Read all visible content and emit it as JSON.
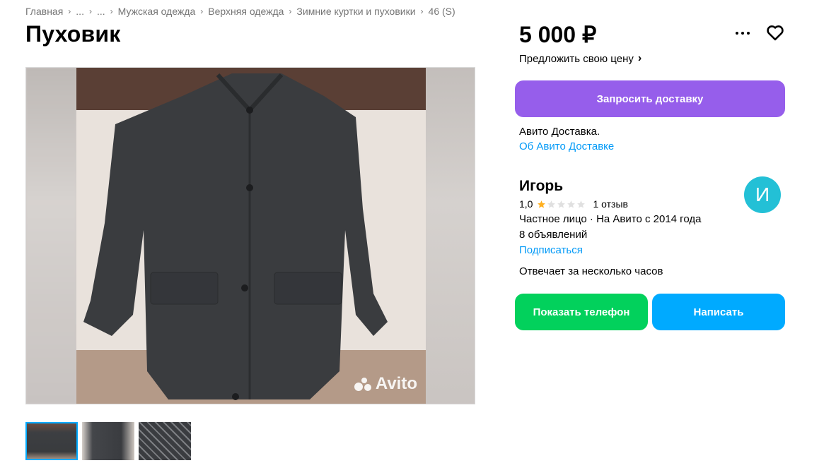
{
  "breadcrumb": [
    {
      "label": "Главная"
    },
    {
      "label": "..."
    },
    {
      "label": "..."
    },
    {
      "label": "Мужская одежда"
    },
    {
      "label": "Верхняя одежда"
    },
    {
      "label": "Зимние куртки и пуховики"
    },
    {
      "label": "46 (S)"
    }
  ],
  "listing": {
    "title": "Пуховик",
    "price": "5 000 ₽",
    "offer_price_label": "Предложить свою цену",
    "watermark": "Avito",
    "thumbnails": 3
  },
  "delivery": {
    "button_label": "Запросить доставку",
    "text": "Авито Доставка.",
    "link": "Об Авито Доставке"
  },
  "seller": {
    "name": "Игорь",
    "avatar_letter": "И",
    "rating": "1,0",
    "rating_stars": 1,
    "reviews": "1 отзыв",
    "type": "Частное лицо · На Авито с 2014 года",
    "listings": "8 объявлений",
    "subscribe": "Подписаться",
    "reply_time": "Отвечает за несколько часов"
  },
  "actions": {
    "phone_label": "Показать телефон",
    "message_label": "Написать"
  },
  "icons": {
    "more": "more-horizontal-icon",
    "favorite": "heart-icon",
    "chevron": "chevron-right-icon"
  },
  "colors": {
    "delivery_button": "#965eeb",
    "phone_button": "#02d15c",
    "message_button": "#00aaff",
    "link": "#0099f7",
    "avatar": "#23c0d6",
    "star": "#ffb021"
  }
}
